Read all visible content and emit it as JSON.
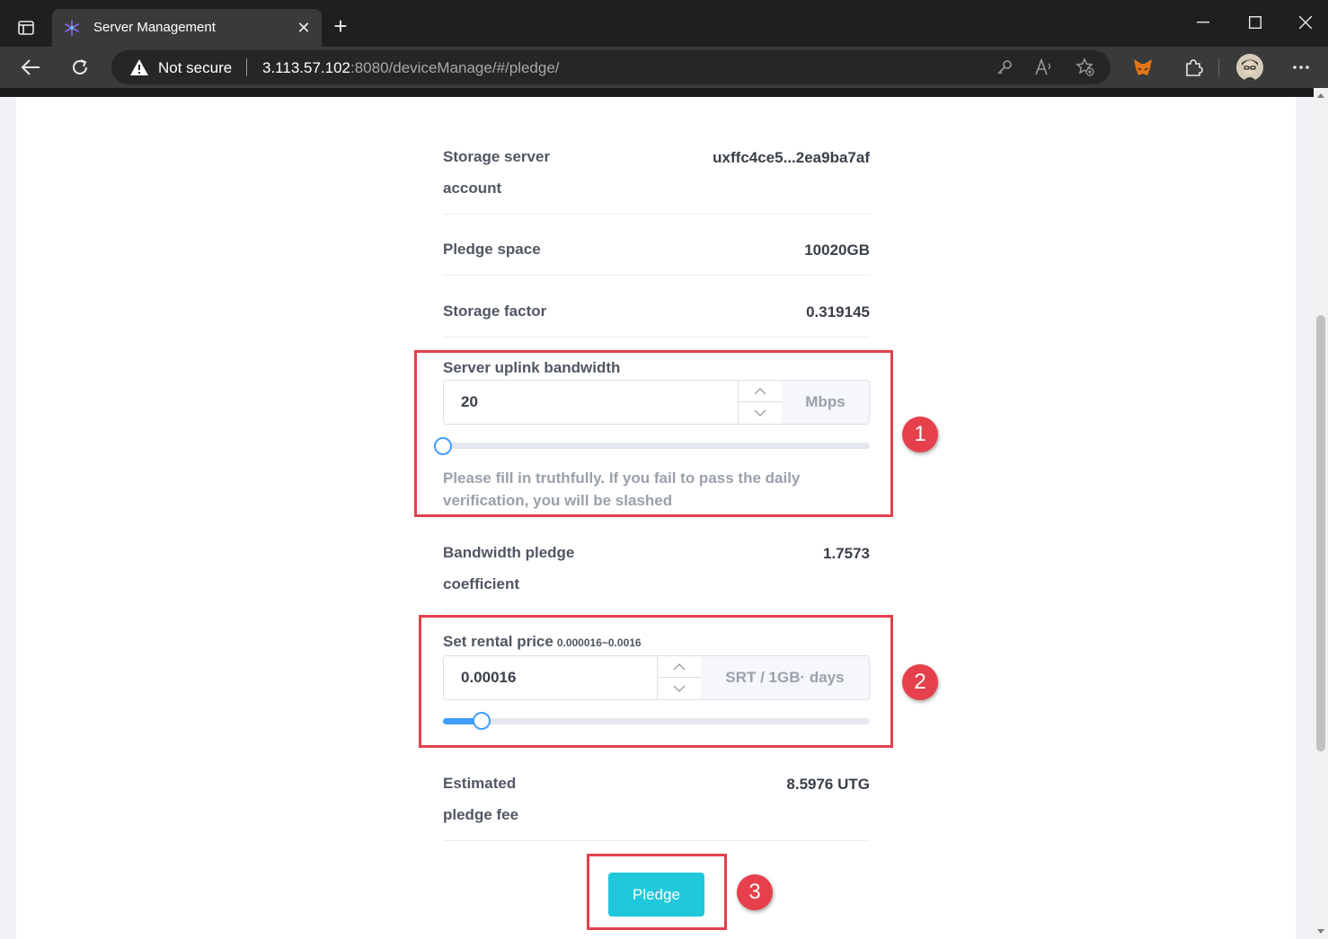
{
  "browser": {
    "tab_title": "Server Management",
    "security_label": "Not secure",
    "url_host": "3.113.57.102",
    "url_rest": ":8080/deviceManage/#/pledge/"
  },
  "form": {
    "account_label_line1": "Storage server",
    "account_label_line2": "account",
    "account_value": "uxffc4ce5...2ea9ba7af",
    "pledge_space_label": "Pledge space",
    "pledge_space_value": "10020GB",
    "storage_factor_label": "Storage factor",
    "storage_factor_value": "0.319145",
    "bandwidth": {
      "label": "Server uplink bandwidth",
      "value": "20",
      "unit": "Mbps",
      "slider_fraction": 0.0,
      "hint_line1": "Please fill in truthfully. If you fail to pass the daily",
      "hint_line2": "verification, you will be slashed"
    },
    "coefficient_label_line1": "Bandwidth pledge",
    "coefficient_label_line2": "coefficient",
    "coefficient_value": "1.7573",
    "rental": {
      "label": "Set rental price",
      "range": "0.000016~0.0016",
      "value": "0.00016",
      "unit": "SRT / 1GB· days",
      "slider_fraction": 0.09
    },
    "fee_label_line1": "Estimated",
    "fee_label_line2": "pledge fee",
    "fee_value": "8.5976 UTG",
    "pledge_button": "Pledge"
  },
  "annotations": [
    "1",
    "2",
    "3"
  ],
  "colors": {
    "accent": "#1fc8db",
    "slider": "#409eff",
    "annotation": "#e5404c"
  }
}
